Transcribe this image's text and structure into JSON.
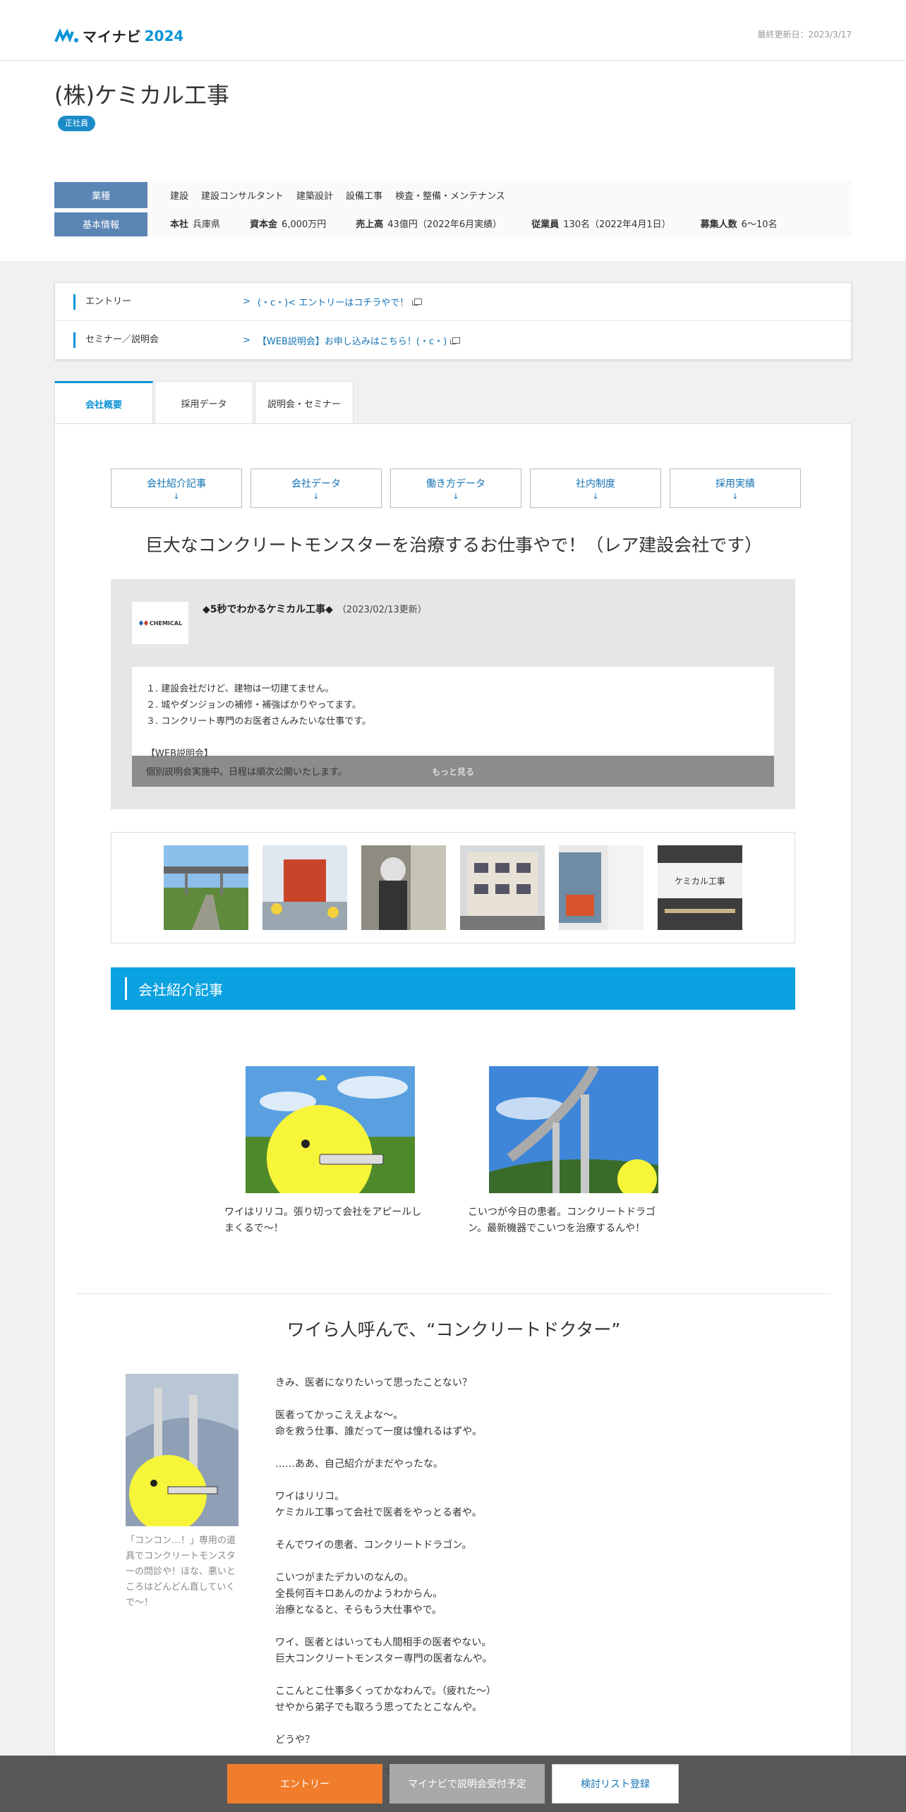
{
  "header": {
    "logo_text": "マイナビ",
    "logo_year": "2024",
    "last_updated": "最終更新日：2023/3/17"
  },
  "company": {
    "name": "(株)ケミカル工事",
    "badge": "正社員",
    "industry_label": "業種",
    "industries": [
      "建設",
      "建設コンサルタント",
      "建築設計",
      "設備工事",
      "検査・整備・メンテナンス"
    ],
    "basic_label": "基本情報",
    "basic": [
      {
        "key": "本社",
        "value": "兵庫県"
      },
      {
        "key": "資本金",
        "value": "6,000万円"
      },
      {
        "key": "売上高",
        "value": "43億円（2022年6月実績）"
      },
      {
        "key": "従業員",
        "value": "130名（2022年4月1日）"
      },
      {
        "key": "募集人数",
        "value": "6～10名"
      }
    ]
  },
  "links": [
    {
      "label": "エントリー",
      "text": "(・c・)< エントリーはコチラやで！"
    },
    {
      "label": "セミナー／説明会",
      "text": "【WEB説明会】お申し込みはこちら！(・c・)"
    }
  ],
  "tabs": [
    "会社概要",
    "採用データ",
    "説明会・セミナー"
  ],
  "anchor_nav": [
    "会社紹介記事",
    "会社データ",
    "働き方データ",
    "社内制度",
    "採用実績"
  ],
  "anchor_arrow": "↓",
  "catchphrase": "巨大なコンクリートモンスターを治療するお仕事やで！（レア建設会社です）",
  "intro": {
    "logo_text": "CHEMICAL",
    "title": "◆5秒でわかるケミカル工事◆",
    "date": "（2023/02/13更新）",
    "lines": [
      "１. 建設会社だけど、建物は一切建てません。",
      "２. 城やダンジョンの補修・補強ばかりやってます。",
      "３. コンクリート専門のお医者さんみたいな仕事です。",
      "",
      "【WEB説明会】"
    ],
    "teaser": "個別説明会実施中。日程は順次公開いたします。",
    "more": "もっと見る"
  },
  "section_title": "会社紹介記事",
  "articles": [
    {
      "caption": "ワイはリリコ。張り切って会社をアピールしまくるで～！"
    },
    {
      "caption": "こいつが今日の患者。コンクリートドラゴン。最新機器でこいつを治療するんや！"
    }
  ],
  "article_title": "ワイら人呼んで、“コンクリートドクター”",
  "side_caption": "「コンコン…！」専用の道具でコンクリートモンスターの問診や！ほな、悪いところはどんどん直していくで～！",
  "body_text": "きみ、医者になりたいって思ったことない？\n\n医者ってかっこええよな～。\n命を救う仕事、誰だって一度は憧れるはずや。\n\n……ああ、自己紹介がまだやったな。\n\nワイはリリコ。\nケミカル工事って会社で医者をやっとる者や。\n\nそんでワイの患者、コンクリートドラゴン。\n\nこいつがまたデカいのなんの。\n全長何百キロあんのかようわからん。\n治療となると、そらもう大仕事やで。\n\nワイ、医者とはいっても人間相手の医者やない。\n巨大コンクリートモンスター専門の医者なんや。\n\nここんとこ仕事多くってかなわんで。（疲れた～）\nせやから弟子でも取ろう思ってたとこなんや。\n\nどうや？\n\nきみ、ワイの弟子になってくれへん？",
  "footer": {
    "entry": "エントリー",
    "seminar": "マイナビで説明会受付予定",
    "list": "検討リスト登録"
  },
  "colors": {
    "accent": "#0a93d6",
    "entry": "#f07d2b",
    "table_head": "#5b85b4"
  }
}
